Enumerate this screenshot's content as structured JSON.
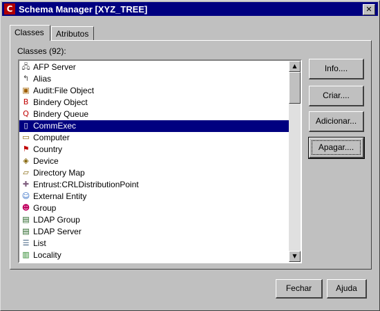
{
  "window": {
    "title": "Schema Manager [XYZ_TREE]",
    "app_icon": "C",
    "close_glyph": "✕"
  },
  "tabs": [
    {
      "label": "Classes",
      "active": true
    },
    {
      "label": "Atributos",
      "active": false
    }
  ],
  "classes_label": "Classes (92):",
  "list": {
    "selected_index": 5,
    "items": [
      {
        "label": "AFP Server",
        "icon": "afp-server-icon"
      },
      {
        "label": "Alias",
        "icon": "alias-icon"
      },
      {
        "label": "Audit:File Object",
        "icon": "audit-file-object-icon"
      },
      {
        "label": "Bindery Object",
        "icon": "bindery-object-icon"
      },
      {
        "label": "Bindery Queue",
        "icon": "bindery-queue-icon"
      },
      {
        "label": "CommExec",
        "icon": "commexec-icon"
      },
      {
        "label": "Computer",
        "icon": "computer-icon"
      },
      {
        "label": "Country",
        "icon": "country-icon"
      },
      {
        "label": "Device",
        "icon": "device-icon"
      },
      {
        "label": "Directory Map",
        "icon": "directory-map-icon"
      },
      {
        "label": "Entrust:CRLDistributionPoint",
        "icon": "entrust-icon"
      },
      {
        "label": "External Entity",
        "icon": "external-entity-icon"
      },
      {
        "label": "Group",
        "icon": "group-icon"
      },
      {
        "label": "LDAP Group",
        "icon": "ldap-group-icon"
      },
      {
        "label": "LDAP Server",
        "icon": "ldap-server-icon"
      },
      {
        "label": "List",
        "icon": "list-icon"
      },
      {
        "label": "Locality",
        "icon": "locality-icon"
      }
    ]
  },
  "side_buttons": {
    "info": "Info....",
    "criar": "Criar....",
    "adicionar": "Adicionar...",
    "apagar": "Apagar...."
  },
  "footer_buttons": {
    "fechar": "Fechar",
    "ajuda": "Ajuda"
  }
}
